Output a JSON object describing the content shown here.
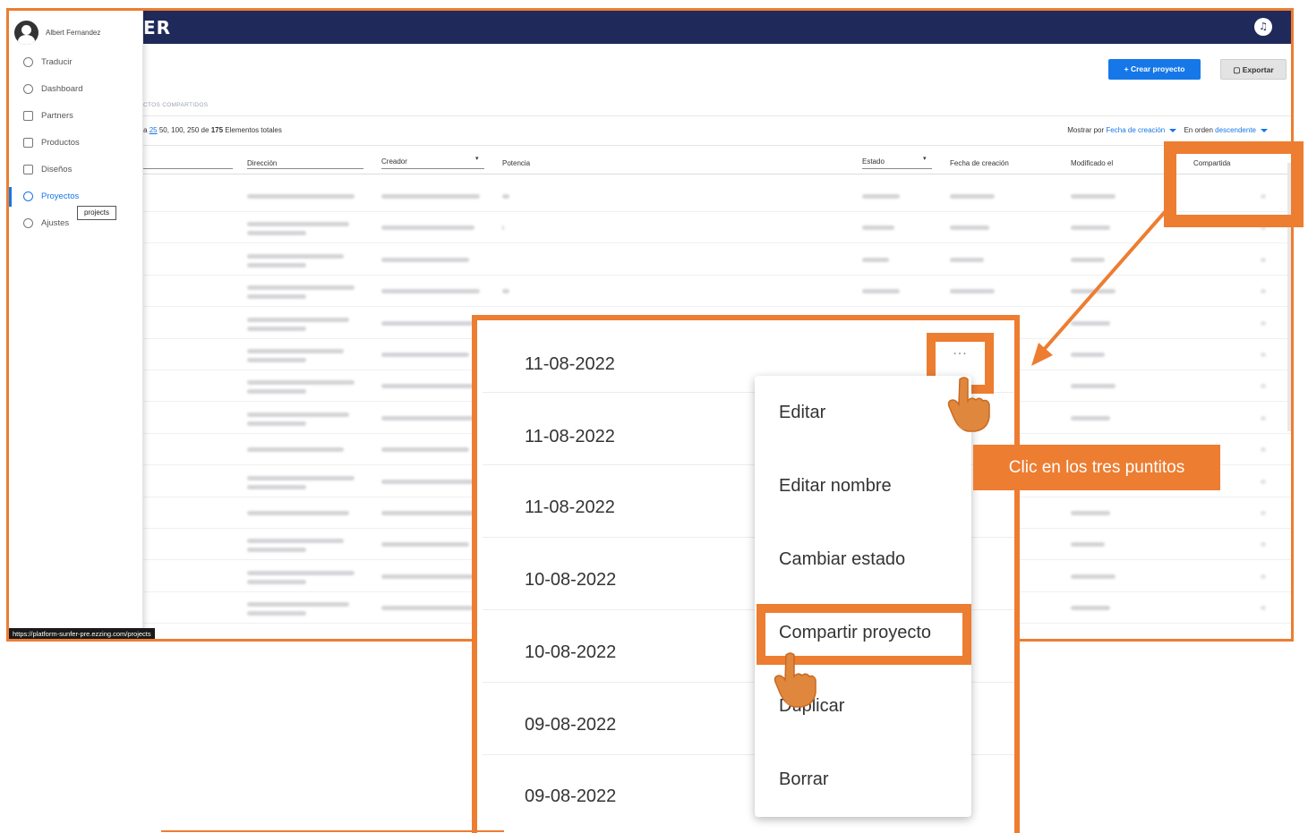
{
  "app": {
    "brand": "ER",
    "user_name": "Albert Fernandez",
    "status_url": "https://platform-sunfer-pre.ezzing.com/projects",
    "tooltip": "projects"
  },
  "sidebar": {
    "items": [
      {
        "label": "Traducir",
        "icon": "translate-icon"
      },
      {
        "label": "Dashboard",
        "icon": "dashboard-icon"
      },
      {
        "label": "Partners",
        "icon": "briefcase-icon"
      },
      {
        "label": "Productos",
        "icon": "product-icon"
      },
      {
        "label": "Diseños",
        "icon": "design-icon"
      },
      {
        "label": "Proyectos",
        "icon": "database-icon",
        "active": true
      },
      {
        "label": "Ajustes",
        "icon": "gear-icon"
      }
    ]
  },
  "toolbar": {
    "create_label": "Crear proyecto",
    "create_icon": "+",
    "export_label": "Exportar"
  },
  "tabs": {
    "shared_label": "CTOS COMPARTIDOS"
  },
  "pager": {
    "prefix": "a",
    "current": "25",
    "others": "50, 100, 250",
    "of_label": "de",
    "total": "175",
    "suffix": "Elementos totales"
  },
  "sort": {
    "show_by_label": "Mostrar por",
    "show_by_value": "Fecha de creación",
    "order_label": "En orden",
    "order_value": "descendente"
  },
  "table": {
    "headers": [
      "Dirección",
      "Creador",
      "Potencia",
      "Estado",
      "Fecha de creación",
      "Modificado el",
      "Compartida"
    ]
  },
  "zoom": {
    "dates": [
      "11-08-2022",
      "11-08-2022",
      "11-08-2022",
      "10-08-2022",
      "10-08-2022",
      "09-08-2022",
      "09-08-2022"
    ],
    "dots": "···",
    "menu": [
      "Editar",
      "Editar nombre",
      "Cambiar estado",
      "Compartir proyecto",
      "Duplicar",
      "Borrar"
    ]
  },
  "callout": {
    "text": "Clic en los tres puntitos"
  },
  "colors": {
    "accent": "#ed7d31",
    "topbar": "#1f2a5a",
    "primary": "#1677e8"
  }
}
